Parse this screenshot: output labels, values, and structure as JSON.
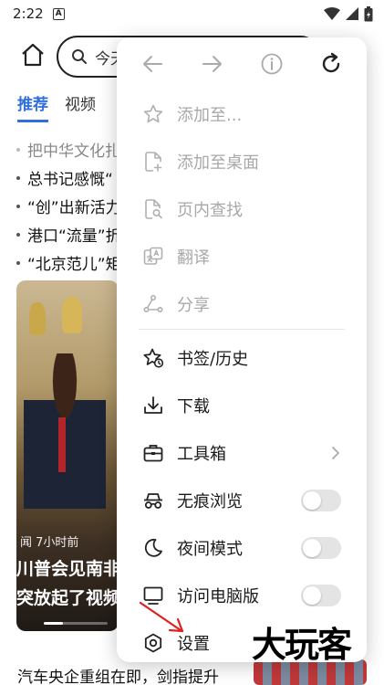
{
  "status_bar": {
    "time": "2:22",
    "app_badge": "A"
  },
  "browser": {
    "search_placeholder": "今天",
    "tabs": [
      {
        "label": "推荐",
        "active": true
      },
      {
        "label": "视频",
        "active": false
      }
    ],
    "news": [
      {
        "text": "把中华文化扎",
        "faded": true
      },
      {
        "text": "总书记感慨“",
        "faded": false
      },
      {
        "text": "“创”出新活力",
        "faded": false
      },
      {
        "text": "港口“流量”折",
        "faded": false
      },
      {
        "text": "“北京范儿”矩",
        "faded": false
      }
    ],
    "feature_card": {
      "meta": "闻  7小时前",
      "title_line1": "川普会见南非",
      "title_line2": "突放起了视频"
    },
    "bottom_news": "汽车央企重组在即，剑指提升"
  },
  "menu": {
    "nav": {
      "back_icon": "arrow-left-icon",
      "forward_icon": "arrow-right-icon",
      "info_icon": "info-icon",
      "refresh_icon": "refresh-icon"
    },
    "items": [
      {
        "label": "添加至...",
        "icon": "star-outline-icon",
        "disabled": true
      },
      {
        "label": "添加至桌面",
        "icon": "add-to-desktop-icon",
        "disabled": true
      },
      {
        "label": "页内查找",
        "icon": "find-in-page-icon",
        "disabled": true
      },
      {
        "label": "翻译",
        "icon": "translate-icon",
        "disabled": true
      },
      {
        "label": "分享",
        "icon": "share-icon",
        "disabled": true
      },
      {
        "label": "书签/历史",
        "icon": "bookmark-history-icon",
        "disabled": false
      },
      {
        "label": "下载",
        "icon": "download-icon",
        "disabled": false
      },
      {
        "label": "工具箱",
        "icon": "toolbox-icon",
        "disabled": false,
        "has_submenu": true
      },
      {
        "label": "无痕浏览",
        "icon": "incognito-icon",
        "disabled": false,
        "toggle": false
      },
      {
        "label": "夜间模式",
        "icon": "moon-icon",
        "disabled": false,
        "toggle": false
      },
      {
        "label": "访问电脑版",
        "icon": "desktop-icon",
        "disabled": false,
        "toggle": false
      },
      {
        "label": "设置",
        "icon": "gear-icon",
        "disabled": false
      }
    ]
  },
  "watermark": "大玩客",
  "colors": {
    "accent": "#2f6fde",
    "disabled_text": "#a8a8a8",
    "annotation_arrow": "#e02020"
  }
}
